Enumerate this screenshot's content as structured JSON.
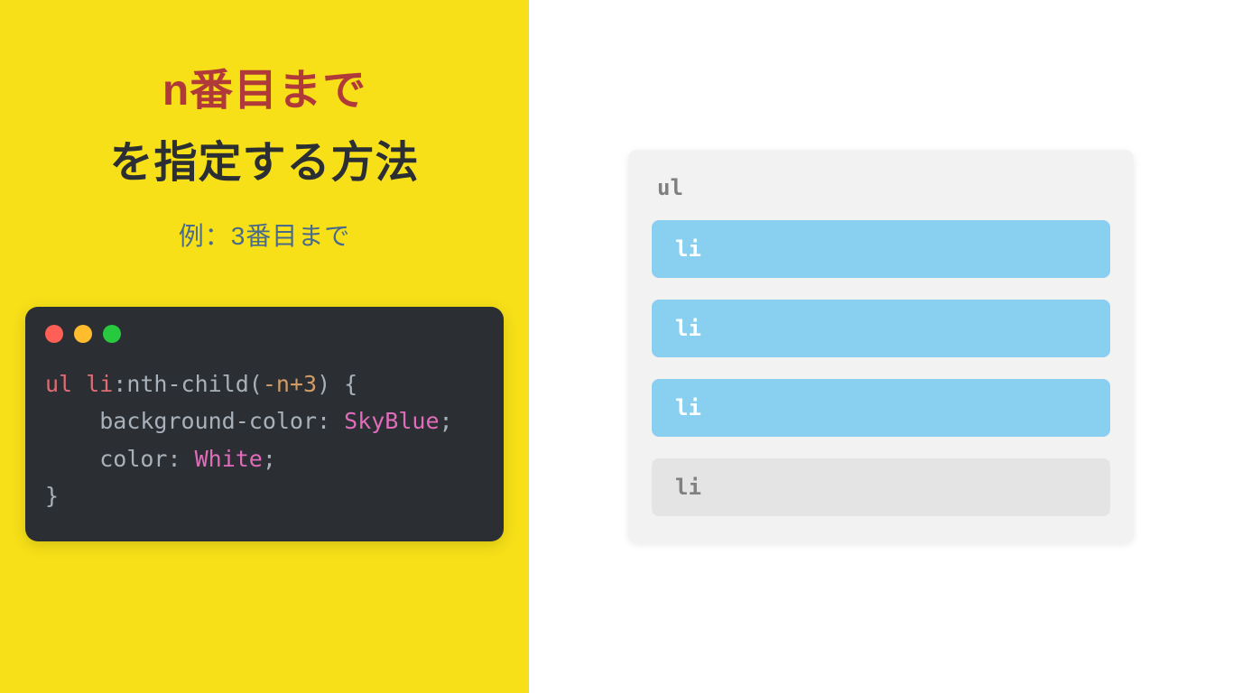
{
  "left": {
    "title_red": "n番目まで",
    "title_black": "を指定する方法",
    "subtitle": "例：3番目まで",
    "code": {
      "selector": "ul li",
      "pseudo": ":nth-child",
      "arg_prefix": "(",
      "arg_n": "-n+3",
      "arg_suffix": ")",
      "brace_open": " {",
      "line2_indent": "    ",
      "prop1": "background-color",
      "colon1": ": ",
      "val1": "SkyBlue",
      "semi1": ";",
      "line3_indent": "    ",
      "prop2": "color",
      "colon2": ": ",
      "val2": "White",
      "semi2": ";",
      "brace_close": "}"
    }
  },
  "right": {
    "container_label": "ul",
    "items": [
      {
        "label": "li",
        "selected": true
      },
      {
        "label": "li",
        "selected": true
      },
      {
        "label": "li",
        "selected": true
      },
      {
        "label": "li",
        "selected": false
      }
    ]
  }
}
